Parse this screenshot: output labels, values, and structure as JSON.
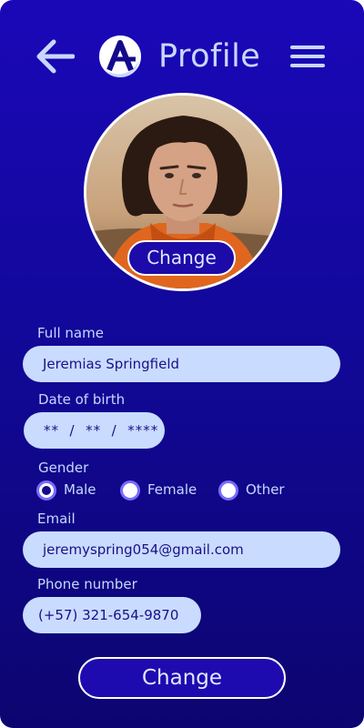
{
  "header": {
    "title": "Profile",
    "back_icon": "arrow-left-icon",
    "logo_icon": "app-logo-a",
    "menu_icon": "hamburger-menu-icon"
  },
  "avatar": {
    "change_label": "Change"
  },
  "form": {
    "full_name": {
      "label": "Full name",
      "value": "Jeremias Springfield"
    },
    "dob": {
      "label": "Date of birth",
      "value": "**  /  **  /  ****"
    },
    "gender": {
      "label": "Gender",
      "options": [
        "Male",
        "Female",
        "Other"
      ],
      "selected": "Male"
    },
    "email": {
      "label": "Email",
      "value": "jeremyspring054@gmail.com"
    },
    "phone": {
      "label": "Phone number",
      "value": "(+57) 321-654-9870"
    }
  },
  "submit_label": "Change",
  "colors": {
    "background_top": "#1a08b8",
    "background_bottom": "#0c0570",
    "field_bg": "#c9dcff",
    "text_light": "#c9d7ff",
    "text_dark": "#1b0f88",
    "radio_ring": "#7a6bff"
  }
}
